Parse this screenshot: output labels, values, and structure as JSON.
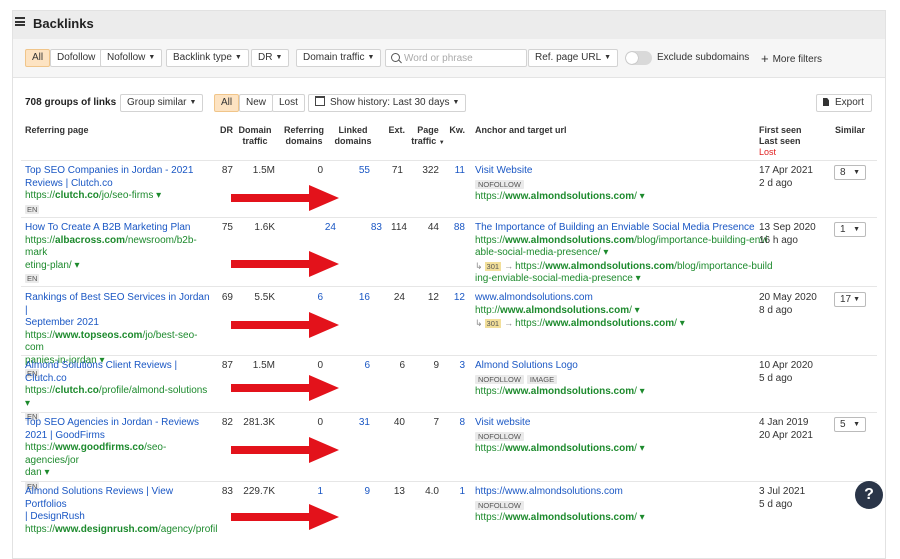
{
  "header": {
    "title": "Backlinks"
  },
  "filters": {
    "all": "All",
    "dofollow": "Dofollow",
    "nofollow": "Nofollow",
    "backlink_type": "Backlink type",
    "dr": "DR",
    "domain_traffic": "Domain traffic",
    "search_placeholder": "Word or phrase",
    "ref_page_url": "Ref. page URL",
    "exclude_subdomains": "Exclude subdomains",
    "more_filters": "More filters"
  },
  "summary": {
    "count": "708 groups of links",
    "group_similar": "Group similar",
    "all": "All",
    "new": "New",
    "lost": "Lost",
    "history": "Show history: Last 30 days",
    "export": "Export"
  },
  "columns": {
    "referring_page": "Referring page",
    "dr": "DR",
    "domain_traffic_1": "Domain",
    "domain_traffic_2": "traffic",
    "referring_domains_1": "Referring",
    "referring_domains_2": "domains",
    "linked_domains_1": "Linked",
    "linked_domains_2": "domains",
    "ext": "Ext.",
    "page_traffic_1": "Page",
    "page_traffic_2": "traffic",
    "kw": "Kw.",
    "anchor": "Anchor and target url",
    "first_seen": "First seen",
    "last_seen": "Last seen",
    "lost": "Lost",
    "similar": "Similar"
  },
  "rows": [
    {
      "title": [
        "Top SEO Companies in Jordan - 2021",
        "Reviews | Clutch.co"
      ],
      "url_parts": [
        "https://",
        "clutch.co",
        "/jo/seo-firms ▾"
      ],
      "lang": "EN",
      "dr": "87",
      "domain_traffic": "1.5M",
      "ref_domains": "0",
      "linked_domains": "55",
      "ext": "71",
      "page_traffic": "322",
      "kw": "11",
      "anchor": "Visit Website",
      "tags": [
        "NOFOLLOW"
      ],
      "target": [
        "https://",
        "www.almondsolutions.com",
        "/ ▾"
      ],
      "first_seen": "17 Apr 2021",
      "last_seen": "2 d ago",
      "similar": "8"
    },
    {
      "title": [
        "How To Create A B2B Marketing Plan"
      ],
      "url_lines": [
        [
          "https://",
          "albacross.com",
          "/newsroom/b2b-mark"
        ],
        [
          "",
          "",
          "eting-plan/ ▾"
        ]
      ],
      "lang": "EN",
      "dr": "75",
      "domain_traffic": "1.6K",
      "ref_domains": "24",
      "linked_domains": "83",
      "ext": "114",
      "page_traffic": "44",
      "kw": "88",
      "anchor": "The Importance of Building an Enviable Social Media Presence",
      "target_lines": [
        [
          "https://",
          "www.almondsolutions.com",
          "/blog/importance-building-envi"
        ],
        [
          "",
          "",
          "able-social-media-presence/ ▾"
        ]
      ],
      "redirect": "301",
      "redirect_lines": [
        [
          "https://",
          "www.almondsolutions.com",
          "/blog/importance-build"
        ],
        [
          "",
          "",
          "ing-enviable-social-media-presence ▾"
        ]
      ],
      "first_seen": "13 Sep 2020",
      "last_seen": "16 h ago",
      "similar": "1"
    },
    {
      "title": [
        "Rankings of Best SEO Services in Jordan |",
        "September 2021"
      ],
      "url_lines": [
        [
          "https://",
          "www.topseos.com",
          "/jo/best-seo-com"
        ],
        [
          "",
          "",
          "panies-in-jordan ▾"
        ]
      ],
      "lang": "EN",
      "dr": "69",
      "domain_traffic": "5.5K",
      "ref_domains": "6",
      "linked_domains": "16",
      "ext": "24",
      "page_traffic": "12",
      "kw": "12",
      "anchor": "www.almondsolutions.com",
      "target": [
        "http://",
        "www.almondsolutions.com",
        "/ ▾"
      ],
      "redirect": "301",
      "redirect_target": [
        "https://",
        "www.almondsolutions.com",
        "/ ▾"
      ],
      "first_seen": "20 May 2020",
      "last_seen": "8 d ago",
      "similar": "17"
    },
    {
      "title": [
        "Almond Solutions Client Reviews |",
        "Clutch.co"
      ],
      "url_parts": [
        "https://",
        "clutch.co",
        "/profile/almond-solutions ▾"
      ],
      "lang": "EN",
      "dr": "87",
      "domain_traffic": "1.5M",
      "ref_domains": "0",
      "linked_domains": "6",
      "ext": "6",
      "page_traffic": "9",
      "kw": "3",
      "anchor": "Almond Solutions Logo",
      "tags": [
        "NOFOLLOW",
        "IMAGE"
      ],
      "target": [
        "https://",
        "www.almondsolutions.com",
        "/ ▾"
      ],
      "first_seen": "10 Apr 2020",
      "last_seen": "5 d ago"
    },
    {
      "title": [
        "Top SEO Agencies in Jordan - Reviews",
        "2021 | GoodFirms"
      ],
      "url_lines": [
        [
          "https://",
          "www.goodfirms.co",
          "/seo-agencies/jor"
        ],
        [
          "",
          "",
          "dan ▾"
        ]
      ],
      "lang": "EN",
      "dr": "82",
      "domain_traffic": "281.3K",
      "ref_domains": "0",
      "linked_domains": "31",
      "ext": "40",
      "page_traffic": "7",
      "kw": "8",
      "anchor": "Visit website",
      "tags": [
        "NOFOLLOW"
      ],
      "target": [
        "https://",
        "www.almondsolutions.com",
        "/ ▾"
      ],
      "first_seen": "4 Jan 2019",
      "last_seen": "20 Apr 2021",
      "similar": "5"
    },
    {
      "title": [
        "Almond Solutions Reviews | View Portfolios",
        "| DesignRush"
      ],
      "url_parts": [
        "https://",
        "www.designrush.com",
        "/agency/profil"
      ],
      "dr": "83",
      "domain_traffic": "229.7K",
      "ref_domains": "1",
      "linked_domains": "9",
      "ext": "13",
      "page_traffic": "4.0",
      "kw": "1",
      "anchor": "https://www.almondsolutions.com",
      "tags": [
        "NOFOLLOW"
      ],
      "target": [
        "https://",
        "www.almondsolutions.com",
        "/ ▾"
      ],
      "first_seen": "3 Jul 2021",
      "last_seen": "5 d ago"
    }
  ],
  "help": "?",
  "colors": {
    "link": "#1a57c4",
    "url": "#1d8a2d",
    "arrow": "#e3121b",
    "active": "#fde3c2",
    "lost": "#e02020"
  }
}
